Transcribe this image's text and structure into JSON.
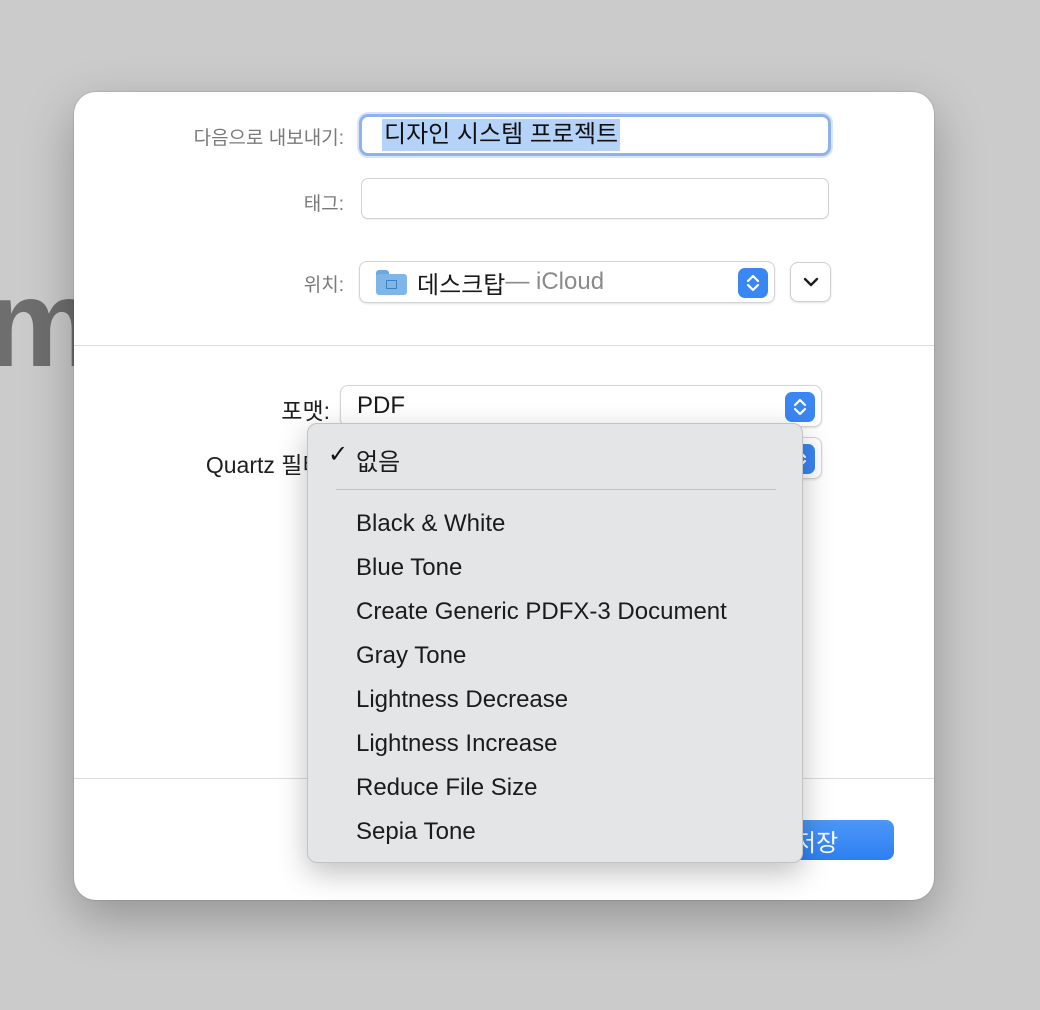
{
  "background": {
    "partial_text": "m"
  },
  "dialog": {
    "export_as_label": "다음으로 내보내기:",
    "export_as_value": "디자인 시스템 프로젝트",
    "tags_label": "태그:",
    "tags_value": "",
    "where_label": "위치:",
    "where_value": "데스크탑",
    "where_sub": " — iCloud",
    "format_label": "포맷:",
    "format_value": "PDF",
    "quartz_label": "Quartz 필터:",
    "save_label": "저장",
    "accent_color": "#3a86f2"
  },
  "quartz_menu": {
    "selected": "없음",
    "items": [
      "Black & White",
      "Blue Tone",
      "Create Generic PDFX-3 Document",
      "Gray Tone",
      "Lightness Decrease",
      "Lightness Increase",
      "Reduce File Size",
      "Sepia Tone"
    ]
  }
}
